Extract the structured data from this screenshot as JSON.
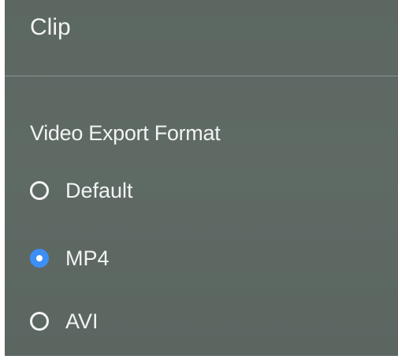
{
  "panel": {
    "title": "Clip"
  },
  "export": {
    "label": "Video Export Format",
    "options": [
      {
        "label": "Default",
        "selected": false
      },
      {
        "label": "MP4",
        "selected": true
      },
      {
        "label": "AVI",
        "selected": false
      }
    ]
  },
  "colors": {
    "background": "#5e6964",
    "text": "#f2f4f3",
    "accent": "#3d8ef5"
  }
}
